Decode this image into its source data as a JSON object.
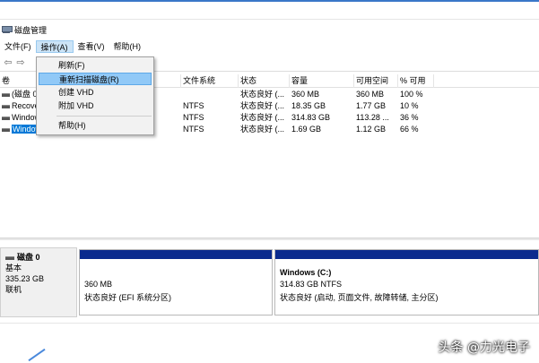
{
  "window": {
    "title": "磁盘管理"
  },
  "menu": [
    "文件(F)",
    "操作(A)",
    "查看(V)",
    "帮助(H)"
  ],
  "toolbar": {
    "back_icon": "back-arrow-icon",
    "forward_icon": "forward-arrow-icon"
  },
  "context_menu": {
    "items": [
      "刷新(F)",
      "重新扫描磁盘(R)",
      "创建 VHD",
      "附加 VHD",
      "帮助(H)"
    ],
    "highlighted": "重新扫描磁盘(R)"
  },
  "table": {
    "columns": [
      "卷",
      "布局",
      "类型",
      "文件系统",
      "状态",
      "容量",
      "可用空间",
      "% 可用"
    ],
    "rows": [
      {
        "vol": "(磁盘 0 磁盘分区 1)",
        "layout": "",
        "type": "",
        "fs": "",
        "status": "状态良好 (...",
        "cap": "360 MB",
        "free": "360 MB",
        "pct": "100 %"
      },
      {
        "vol": "Recovery",
        "layout": "",
        "type": "",
        "fs": "NTFS",
        "status": "状态良好 (...",
        "cap": "18.35 GB",
        "free": "1.77 GB",
        "pct": "10 %"
      },
      {
        "vol": "Windows (C:)",
        "layout": "",
        "type": "",
        "fs": "NTFS",
        "status": "状态良好 (...",
        "cap": "314.83 GB",
        "free": "113.28 ...",
        "pct": "36 %"
      },
      {
        "vol": "Windows RE tools",
        "layout": "",
        "type": "",
        "fs": "NTFS",
        "status": "状态良好 (...",
        "cap": "1.69 GB",
        "free": "1.12 GB",
        "pct": "66 %"
      }
    ]
  },
  "disk": {
    "name": "磁盘 0",
    "type": "基本",
    "size": "335.23 GB",
    "state": "联机",
    "partitions": [
      {
        "title": "",
        "size": "360 MB",
        "status": "状态良好 (EFI 系统分区)"
      },
      {
        "title": "Windows  (C:)",
        "size": "314.83 GB NTFS",
        "status": "状态良好 (启动, 页面文件, 故障转储, 主分区)"
      }
    ]
  },
  "watermark": "头条 @力光电子"
}
